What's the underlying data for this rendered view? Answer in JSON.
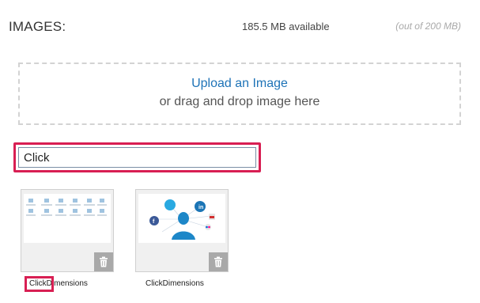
{
  "header": {
    "title": "IMAGES:",
    "storage_available": "185.5 MB available",
    "storage_total": "(out of 200 MB)"
  },
  "upload": {
    "link_label": "Upload an Image",
    "drop_hint": "or drag and drop image here"
  },
  "search": {
    "value": "Click"
  },
  "images": [
    {
      "name": "ClickDimensions"
    },
    {
      "name": "ClickDimensions"
    }
  ],
  "colors": {
    "accent": "#1e73b7",
    "highlight": "#d81f53",
    "delete_button": "#a9a9a9"
  }
}
